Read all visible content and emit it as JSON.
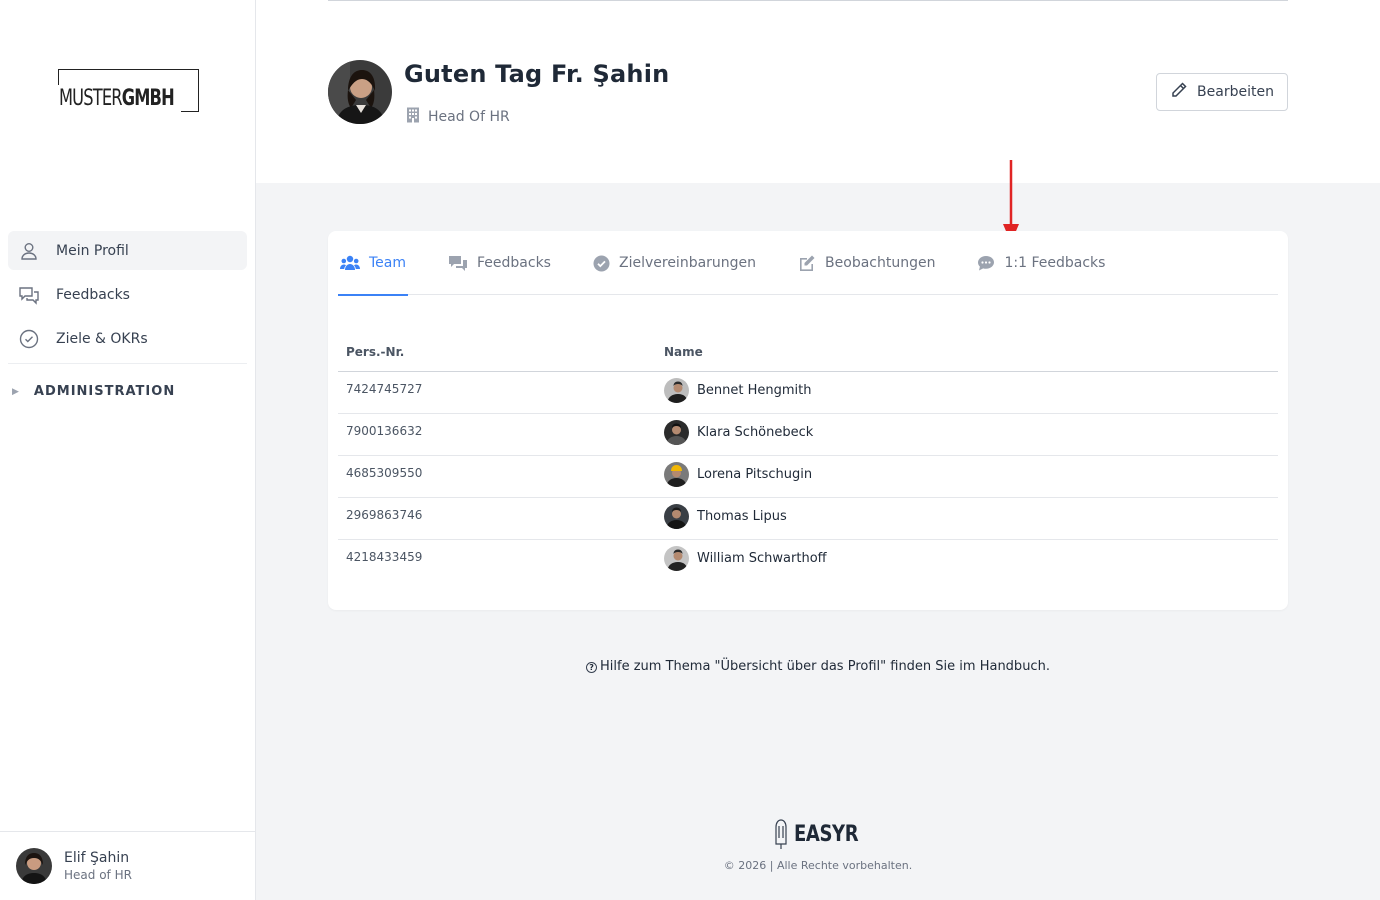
{
  "brand": {
    "logo_light": "MUSTER",
    "logo_bold": "GMBH"
  },
  "sidebar": {
    "items": [
      {
        "label": "Mein Profil",
        "icon": "user-icon",
        "active": true
      },
      {
        "label": "Feedbacks",
        "icon": "chat-bubbles-icon",
        "active": false
      },
      {
        "label": "Ziele & OKRs",
        "icon": "check-circle-icon",
        "active": false
      }
    ],
    "admin_label": "ADMINISTRATION",
    "user": {
      "name": "Elif Şahin",
      "role": "Head of HR"
    }
  },
  "header": {
    "greeting": "Guten Tag Fr. Şahin",
    "job_title": "Head Of HR",
    "edit_label": "Bearbeiten"
  },
  "tabs": [
    {
      "label": "Team",
      "icon": "users-icon",
      "active": true
    },
    {
      "label": "Feedbacks",
      "icon": "comments-icon",
      "active": false
    },
    {
      "label": "Zielvereinbarungen",
      "icon": "check-circle-icon",
      "active": false
    },
    {
      "label": "Beobachtungen",
      "icon": "edit-icon",
      "active": false
    },
    {
      "label": "1:1 Feedbacks",
      "icon": "comment-dots-icon",
      "active": false
    }
  ],
  "table": {
    "headers": {
      "pers_nr": "Pers.-Nr.",
      "name": "Name"
    },
    "rows": [
      {
        "pers_nr": "7424745727",
        "name": "Bennet Hengmith"
      },
      {
        "pers_nr": "7900136632",
        "name": "Klara Schönebeck"
      },
      {
        "pers_nr": "4685309550",
        "name": "Lorena Pitschugin"
      },
      {
        "pers_nr": "2969863746",
        "name": "Thomas Lipus"
      },
      {
        "pers_nr": "4218433459",
        "name": "William Schwarthoff"
      }
    ]
  },
  "help": {
    "icon": "question-circle-icon",
    "text": "Hilfe zum Thema \"Übersicht über das Profil\" finden Sie im Handbuch."
  },
  "footer": {
    "brand": "EASYR",
    "copyright": "© 2026 | Alle Rechte vorbehalten."
  },
  "colors": {
    "accent": "#3b82f6",
    "arrow": "#e02424",
    "background": "#f3f4f6"
  }
}
